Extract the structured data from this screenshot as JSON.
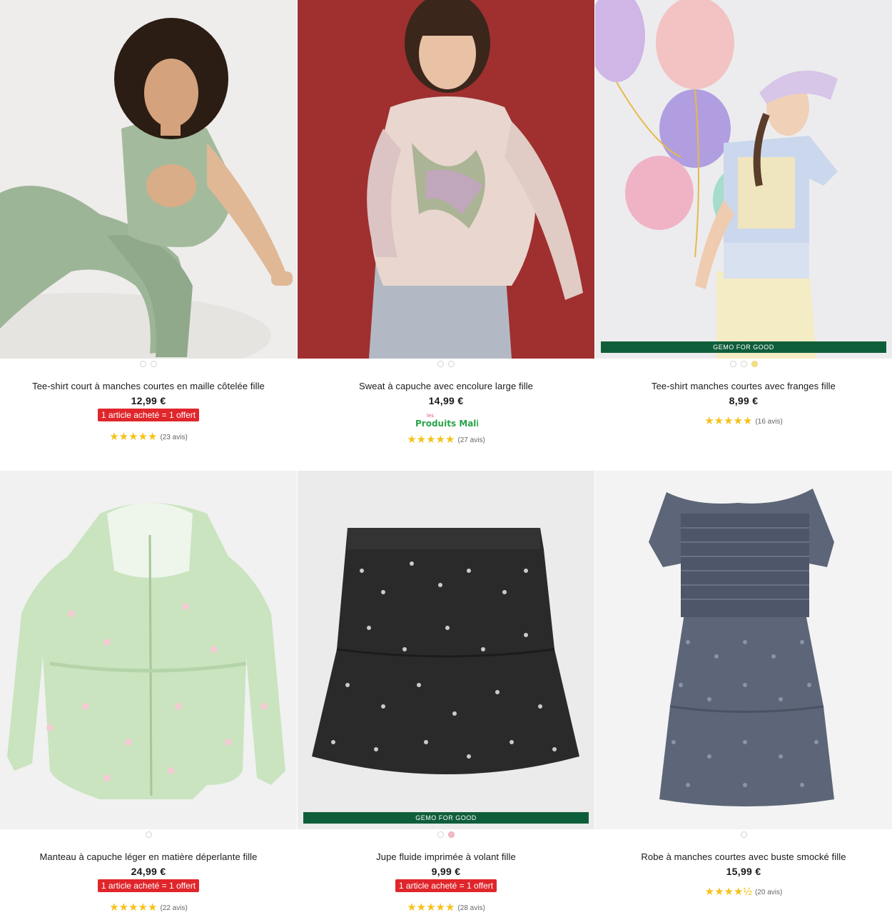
{
  "products": [
    {
      "title": "Tee-shirt court à manches courtes en maille côtelée fille",
      "price": "12,99 €",
      "promo": "1 article acheté = 1 offert",
      "stars": "★★★★★",
      "reviews": "(23 avis)",
      "dots": 2,
      "active_dot": -1
    },
    {
      "title": "Sweat à capuche avec encolure large fille",
      "price": "14,99 €",
      "badge_logo_top": "les",
      "badge_logo": "Produits Malins",
      "stars": "★★★★★",
      "reviews": "(27 avis)",
      "dots": 2,
      "active_dot": -1
    },
    {
      "title": "Tee-shirt manches courtes avec franges fille",
      "price": "8,99 €",
      "ribbon": "GEMO FOR GOOD",
      "stars": "★★★★★",
      "reviews": "(16 avis)",
      "dots": 3,
      "active_dot": 2
    },
    {
      "title": "Manteau à capuche léger en matière déperlante fille",
      "price": "24,99 €",
      "promo": "1 article acheté = 1 offert",
      "stars": "★★★★★",
      "reviews": "(22 avis)",
      "dots": 1,
      "active_dot": -1
    },
    {
      "title": "Jupe fluide imprimée à volant fille",
      "price": "9,99 €",
      "promo": "1 article acheté = 1 offert",
      "ribbon": "GEMO FOR GOOD",
      "stars": "★★★★★",
      "reviews": "(28 avis)",
      "dots": 2,
      "active_dot": 1
    },
    {
      "title": "Robe à manches courtes avec buste smocké fille",
      "price": "15,99 €",
      "stars": "★★★★½",
      "reviews": "(20 avis)",
      "dots": 1,
      "active_dot": -1
    }
  ],
  "colors": {
    "promo_red": "#e0262b",
    "star_yellow": "#f3c31a",
    "ribbon_green": "#0f5e3a"
  }
}
